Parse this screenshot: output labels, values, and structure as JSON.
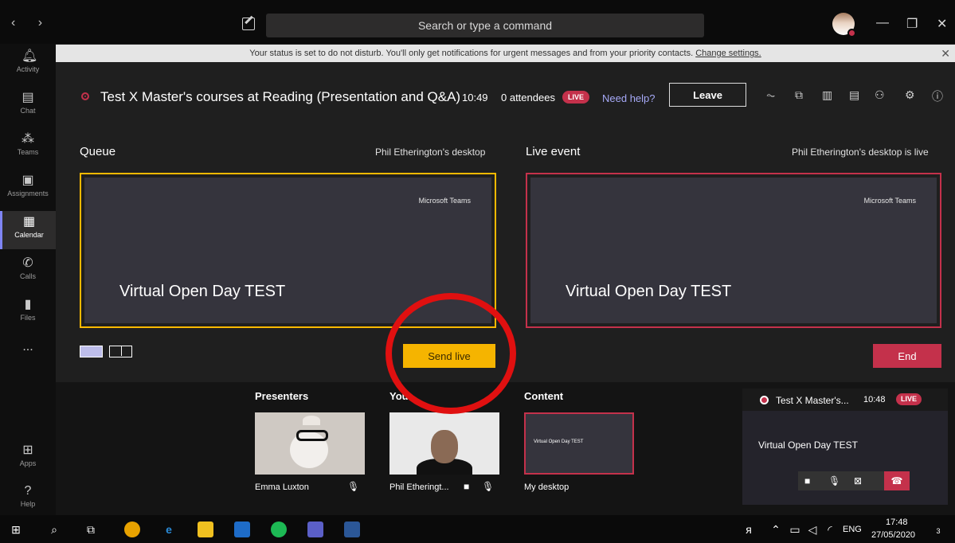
{
  "titlebar": {
    "nav": "‹ ›",
    "search_placeholder": "Search or type a command",
    "minimize": "—",
    "maximize": "❐",
    "close": "✕"
  },
  "rail": {
    "items": [
      {
        "label": "Activity",
        "icon": "bell-icon"
      },
      {
        "label": "Chat",
        "icon": "chat-icon"
      },
      {
        "label": "Teams",
        "icon": "teams-icon"
      },
      {
        "label": "Assignments",
        "icon": "assignments-icon"
      },
      {
        "label": "Calendar",
        "icon": "calendar-icon"
      },
      {
        "label": "Calls",
        "icon": "phone-icon"
      },
      {
        "label": "Files",
        "icon": "file-icon"
      },
      {
        "label": "...",
        "icon": "more-icon"
      },
      {
        "label": "Apps",
        "icon": "apps-icon"
      },
      {
        "label": "Help",
        "icon": "help-icon"
      }
    ]
  },
  "banner": {
    "text": "Your status is set to do not disturb. You'll only get notifications for urgent messages and from your priority contacts. ",
    "link": "Change settings."
  },
  "meeting": {
    "title": "Test X Master's courses at Reading (Presentation and Q&A)",
    "time": "10:49",
    "attendees": "0 attendees",
    "live": "LIVE",
    "need_help": "Need help?",
    "leave": "Leave"
  },
  "queue": {
    "title": "Queue",
    "subtitle": "Phil Etherington's desktop",
    "brand": "Microsoft Teams",
    "slide_title": "Virtual Open Day TEST",
    "send_live": "Send live"
  },
  "live": {
    "title": "Live event",
    "subtitle": "Phil Etherington's desktop is live",
    "brand": "Microsoft Teams",
    "slide_title": "Virtual Open Day TEST",
    "end": "End"
  },
  "strip": {
    "presenters_label": "Presenters",
    "you_label": "You",
    "content_label": "Content",
    "presenter_name": "Emma Luxton",
    "you_name": "Phil Etheringt...",
    "content_name": "My desktop",
    "content_mini_title": "Virtual Open Day TEST"
  },
  "mini_player": {
    "title": "Test X Master's...",
    "time": "10:48",
    "live": "LIVE",
    "slide_title": "Virtual Open Day TEST",
    "hangup": "☎"
  },
  "taskbar": {
    "lang": "ENG",
    "time": "17:48",
    "date": "27/05/2020",
    "notif_count": "3"
  }
}
